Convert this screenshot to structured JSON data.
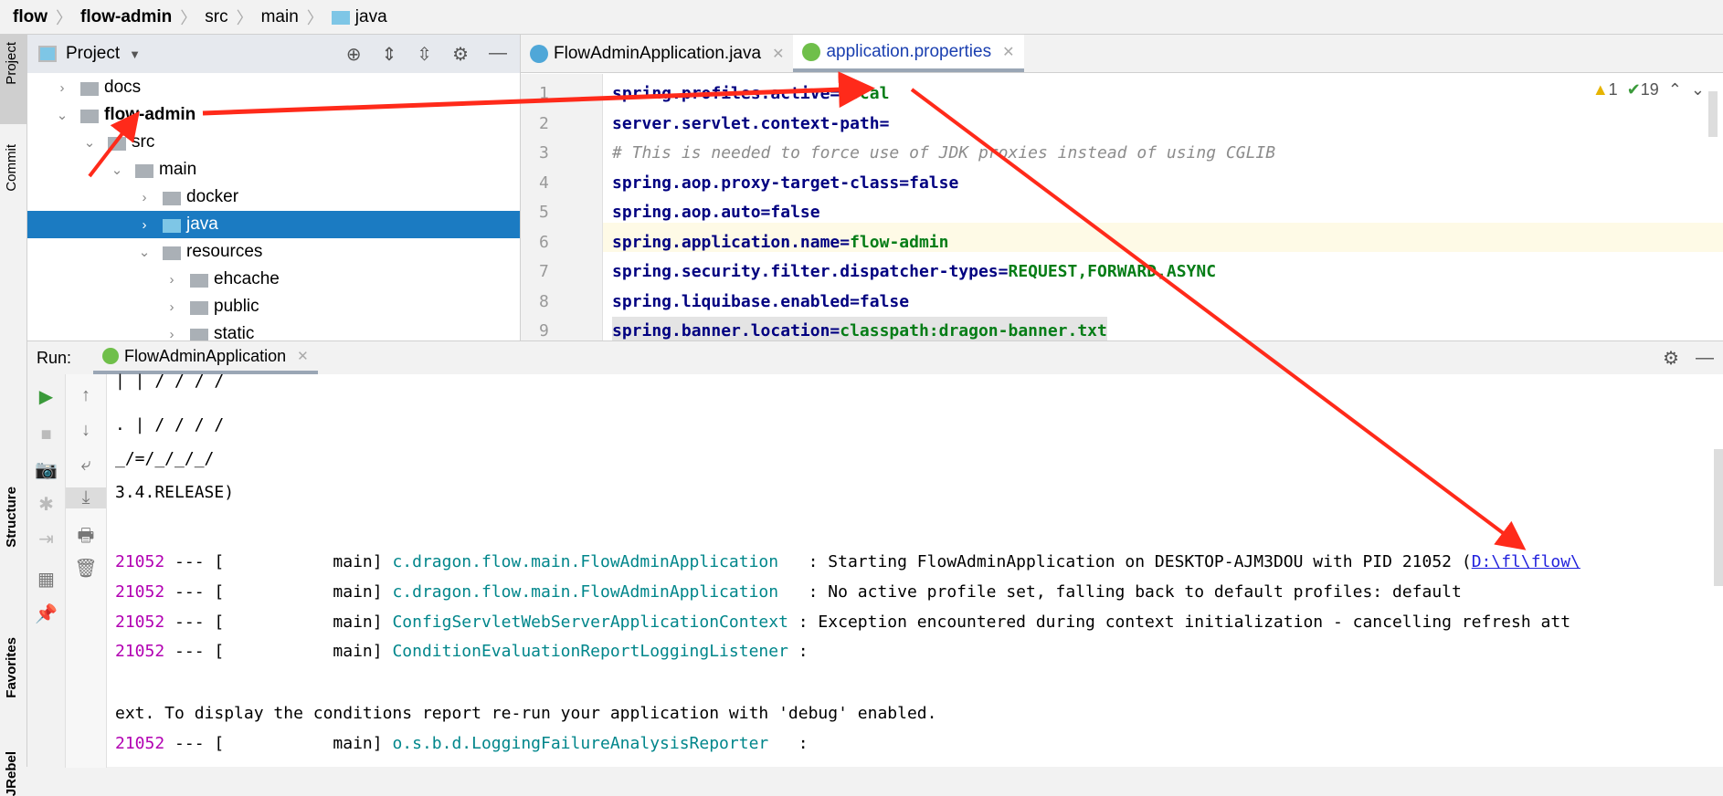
{
  "breadcrumb": [
    "flow",
    "flow-admin",
    "src",
    "main",
    "java"
  ],
  "left_stripe": {
    "project": "Project",
    "commit": "Commit",
    "structure": "Structure",
    "favorites": "Favorites",
    "jrebel": "JRebel"
  },
  "project_panel": {
    "title": "Project",
    "tree": [
      {
        "label": "docs",
        "expanded": false
      },
      {
        "label": "flow-admin",
        "expanded": true
      },
      {
        "label": "src",
        "expanded": true
      },
      {
        "label": "main",
        "expanded": true
      },
      {
        "label": "docker",
        "expanded": false
      },
      {
        "label": "java",
        "expanded": false,
        "selected": true
      },
      {
        "label": "resources",
        "expanded": true
      },
      {
        "label": "ehcache",
        "expanded": false
      },
      {
        "label": "public",
        "expanded": false
      },
      {
        "label": "static",
        "expanded": false
      }
    ]
  },
  "editor": {
    "tabs": [
      {
        "label": "FlowAdminApplication.java",
        "active": false
      },
      {
        "label": "application.properties",
        "active": true
      }
    ],
    "warnings": "1",
    "checks": "19",
    "lines": [
      {
        "n": "1",
        "key": "spring.profiles.active=",
        "val": "local"
      },
      {
        "n": "2",
        "key": "server.servlet.context-path=",
        "val": ""
      },
      {
        "n": "3",
        "comment": "# This is needed to force use of JDK proxies instead of using CGLIB"
      },
      {
        "n": "4",
        "key": "spring.aop.proxy-target-class=false",
        "val": ""
      },
      {
        "n": "5",
        "key": "spring.aop.auto=false",
        "val": ""
      },
      {
        "n": "6",
        "key": "spring.application.name=",
        "val": "flow-admin"
      },
      {
        "n": "7",
        "key": "spring.security.filter.dispatcher-types=",
        "val": "REQUEST,FORWARD,ASYNC"
      },
      {
        "n": "8",
        "key": "spring.liquibase.enabled=false",
        "val": ""
      },
      {
        "n": "9",
        "key": "spring.banner.location=",
        "val": "classpath:dragon-banner.txt"
      }
    ]
  },
  "run": {
    "label": "Run:",
    "tab": "FlowAdminApplication",
    "console": [
      {
        "text": "| | / / / /"
      },
      {
        "text": ". | / / / /"
      },
      {
        "text": "_/=/_/_/_/"
      },
      {
        "text": "3.4.RELEASE)"
      },
      {
        "pid": "21052",
        "mid": " --- [           main] ",
        "cls": "c.dragon.flow.main.FlowAdminApplication  ",
        "msg": " : Starting FlowAdminApplication on DESKTOP-AJM3DOU with PID 21052 (",
        "link": "D:\\fl\\flow\\"
      },
      {
        "pid": "21052",
        "mid": " --- [           main] ",
        "cls": "c.dragon.flow.main.FlowAdminApplication  ",
        "msg": " : No active profile set, falling back to default profiles: default"
      },
      {
        "pid": "21052",
        "mid": " --- [           main] ",
        "cls": "ConfigServletWebServerApplicationContext",
        "msg": " : Exception encountered during context initialization - cancelling refresh att"
      },
      {
        "pid": "21052",
        "mid": " --- [           main] ",
        "cls": "ConditionEvaluationReportLoggingListener",
        "msg": " :"
      },
      {
        "text": "ext. To display the conditions report re-run your application with 'debug' enabled."
      },
      {
        "pid": "21052",
        "mid": " --- [           main] ",
        "cls": "o.s.b.d.LoggingFailureAnalysisReporter  ",
        "msg": " :"
      }
    ]
  },
  "colors": {
    "selection": "#1b7bc2",
    "annotation_arrow": "#ff2a1a",
    "key": "#000080",
    "value": "#067d17"
  }
}
